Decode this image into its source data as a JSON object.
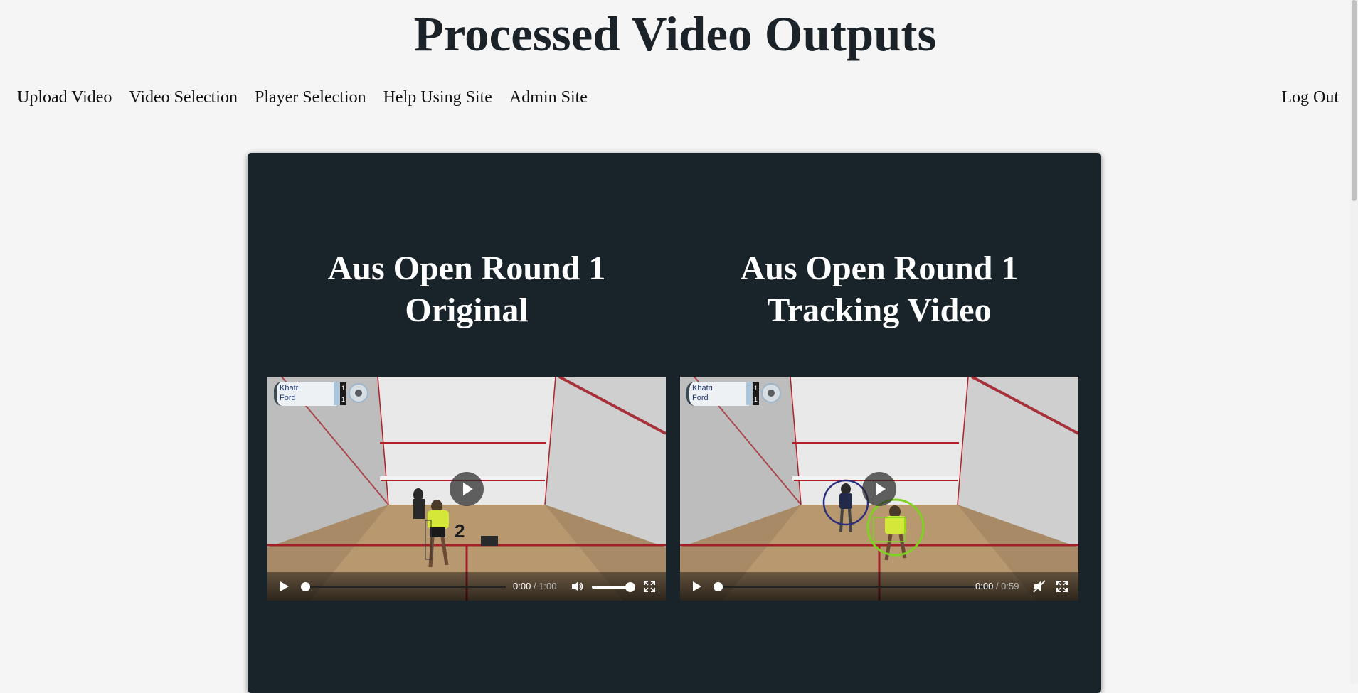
{
  "header": {
    "title": "Processed Video Outputs"
  },
  "nav": {
    "items": [
      "Upload Video",
      "Video Selection",
      "Player Selection",
      "Help Using Site",
      "Admin Site"
    ],
    "logout": "Log Out"
  },
  "videos": [
    {
      "title_line1": "Aus Open Round 1",
      "title_line2": "Original",
      "scoreboard": {
        "player1": "Khatri",
        "player2": "Ford",
        "points": [
          "1",
          "1"
        ]
      },
      "overlay_number": "2",
      "current_time": "0:00",
      "duration": "/ 1:00",
      "muted": false,
      "volume": 1.0,
      "progress": 0
    },
    {
      "title_line1": "Aus Open Round 1",
      "title_line2": "Tracking Video",
      "scoreboard": {
        "player1": "Khatri",
        "player2": "Ford",
        "points": [
          "1",
          "1"
        ]
      },
      "current_time": "0:00",
      "duration": "/ 0:59",
      "muted": true,
      "progress": 0,
      "tracking_colors": {
        "player_dark": "#2a2d7a",
        "player_light": "#7ed321"
      }
    }
  ],
  "icons": {
    "play": "play-icon",
    "volume": "volume-icon",
    "muted": "volume-muted-icon",
    "fullscreen": "fullscreen-icon"
  },
  "colors": {
    "panel_bg": "#19232a",
    "page_bg": "#f5f5f5",
    "title_text": "#1b2329"
  }
}
